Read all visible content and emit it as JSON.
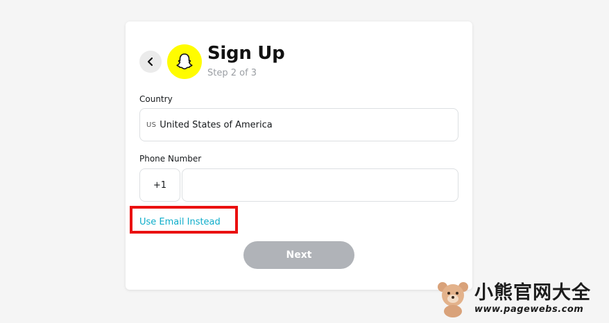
{
  "header": {
    "title": "Sign Up",
    "step": "Step 2 of 3"
  },
  "icons": {
    "back": "chevron-left-icon",
    "logo": "snapchat-ghost-icon",
    "watermark_logo": "bear-mascot-icon"
  },
  "form": {
    "country_label": "Country",
    "country_code": "US",
    "country_value": "United States of America",
    "phone_label": "Phone Number",
    "dial_code": "+1",
    "phone_value": "",
    "use_email_link": "Use Email Instead",
    "next_label": "Next"
  },
  "watermark": {
    "name": "小熊官网大全",
    "url": "www.pagewebs.com"
  },
  "colors": {
    "brand_yellow": "#fffc00",
    "link": "#0fadca",
    "highlight": "#ea1010",
    "button_disabled": "#b0b3b8"
  }
}
